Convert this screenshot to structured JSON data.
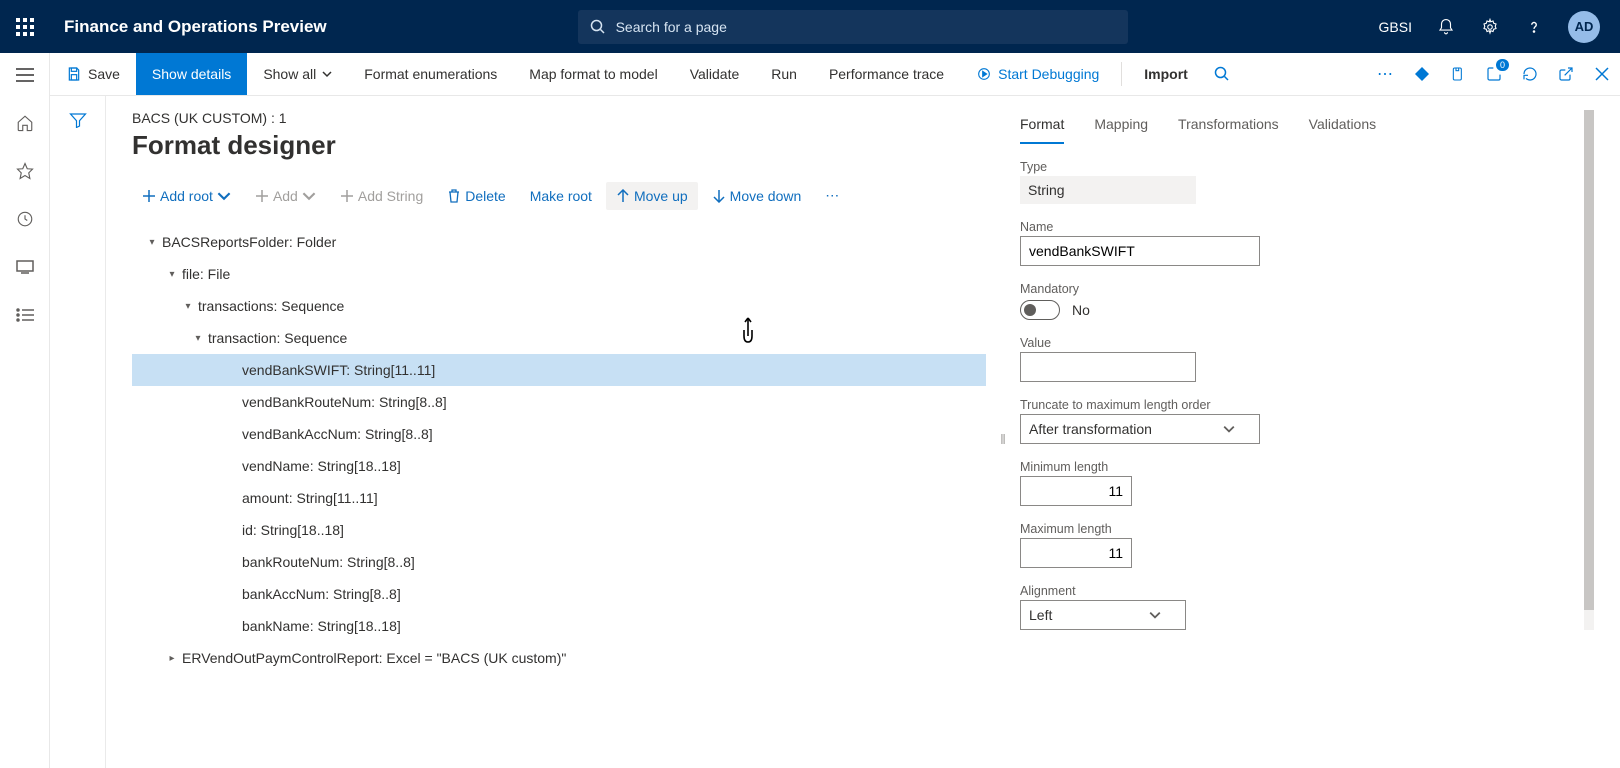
{
  "header": {
    "app_title": "Finance and Operations Preview",
    "search_placeholder": "Search for a page",
    "org": "GBSI",
    "avatar_initials": "AD"
  },
  "toolbar": {
    "save": "Save",
    "show_details": "Show details",
    "show_all": "Show all",
    "format_enum": "Format enumerations",
    "map_format": "Map format to model",
    "validate": "Validate",
    "run": "Run",
    "perf_trace": "Performance trace",
    "start_debug": "Start Debugging",
    "import_": "Import",
    "badge_count": "0"
  },
  "page": {
    "breadcrumb": "BACS (UK CUSTOM) : 1",
    "title": "Format designer"
  },
  "actions": {
    "add_root": "Add root",
    "add": "Add",
    "add_string": "Add String",
    "delete_": "Delete",
    "make_root": "Make root",
    "move_up": "Move up",
    "move_down": "Move down"
  },
  "tree": [
    {
      "level": 0,
      "caret": "down",
      "label": "BACSReportsFolder: Folder"
    },
    {
      "level": 1,
      "caret": "down",
      "label": "file: File"
    },
    {
      "level": 2,
      "caret": "down",
      "label": "transactions: Sequence"
    },
    {
      "level": 3,
      "caret": "down",
      "label": "transaction: Sequence"
    },
    {
      "level": 4,
      "caret": "",
      "label": "vendBankSWIFT: String[11..11]",
      "selected": true
    },
    {
      "level": 4,
      "caret": "",
      "label": "vendBankRouteNum: String[8..8]"
    },
    {
      "level": 4,
      "caret": "",
      "label": "vendBankAccNum: String[8..8]"
    },
    {
      "level": 4,
      "caret": "",
      "label": "vendName: String[18..18]"
    },
    {
      "level": 4,
      "caret": "",
      "label": "amount: String[11..11]"
    },
    {
      "level": 4,
      "caret": "",
      "label": "id: String[18..18]"
    },
    {
      "level": 4,
      "caret": "",
      "label": "bankRouteNum: String[8..8]"
    },
    {
      "level": 4,
      "caret": "",
      "label": "bankAccNum: String[8..8]"
    },
    {
      "level": 4,
      "caret": "",
      "label": "bankName: String[18..18]"
    },
    {
      "level": 1,
      "caret": "right",
      "label": "ERVendOutPaymControlReport: Excel = \"BACS (UK custom)\""
    }
  ],
  "prop_tabs": {
    "format": "Format",
    "mapping": "Mapping",
    "transformations": "Transformations",
    "validations": "Validations"
  },
  "props": {
    "type_label": "Type",
    "type_value": "String",
    "name_label": "Name",
    "name_value": "vendBankSWIFT",
    "mandatory_label": "Mandatory",
    "mandatory_value": "No",
    "value_label": "Value",
    "value_value": "",
    "truncate_label": "Truncate to maximum length order",
    "truncate_value": "After transformation",
    "min_label": "Minimum length",
    "min_value": "11",
    "max_label": "Maximum length",
    "max_value": "11",
    "align_label": "Alignment",
    "align_value": "Left"
  }
}
